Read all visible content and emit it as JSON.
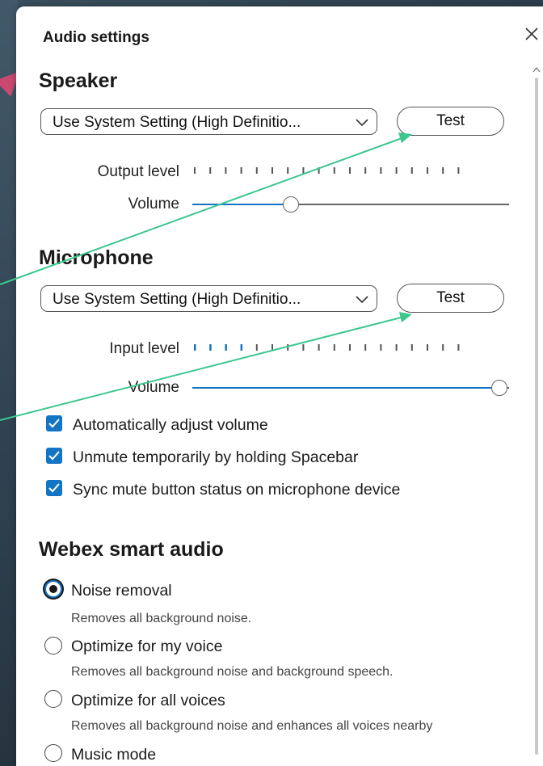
{
  "dialog": {
    "title": "Audio settings"
  },
  "speaker": {
    "heading": "Speaker",
    "device": "Use System Setting (High Definitio...",
    "test_label": "Test",
    "output_level_label": "Output level",
    "volume_label": "Volume",
    "volume_fraction": 0.31,
    "output_level_active_ticks": 0
  },
  "microphone": {
    "heading": "Microphone",
    "device": "Use System Setting (High Definitio...",
    "test_label": "Test",
    "input_level_label": "Input level",
    "volume_label": "Volume",
    "volume_fraction": 0.97,
    "input_level_active_ticks": 4
  },
  "options": [
    {
      "label": "Automatically adjust volume",
      "checked": true
    },
    {
      "label": "Unmute temporarily by holding Spacebar",
      "checked": true
    },
    {
      "label": "Sync mute button status on microphone device",
      "checked": true
    }
  ],
  "smart_audio": {
    "heading": "Webex smart audio",
    "modes": [
      {
        "label": "Noise removal",
        "desc": "Removes all background noise.",
        "selected": true
      },
      {
        "label": "Optimize for my voice",
        "desc": "Removes all background noise and background speech.",
        "selected": false
      },
      {
        "label": "Optimize for all voices",
        "desc": "Removes all background noise and enhances all voices nearby",
        "selected": false
      },
      {
        "label": "Music mode",
        "desc": "",
        "selected": false
      }
    ]
  },
  "colors": {
    "accent": "#1474c4",
    "annotation_arrow": "#3cc78f",
    "background_arrow": "#c94a6e"
  },
  "icons": [
    "close-icon",
    "chevron-down-icon",
    "checkmark-icon",
    "scroll-up-icon"
  ]
}
